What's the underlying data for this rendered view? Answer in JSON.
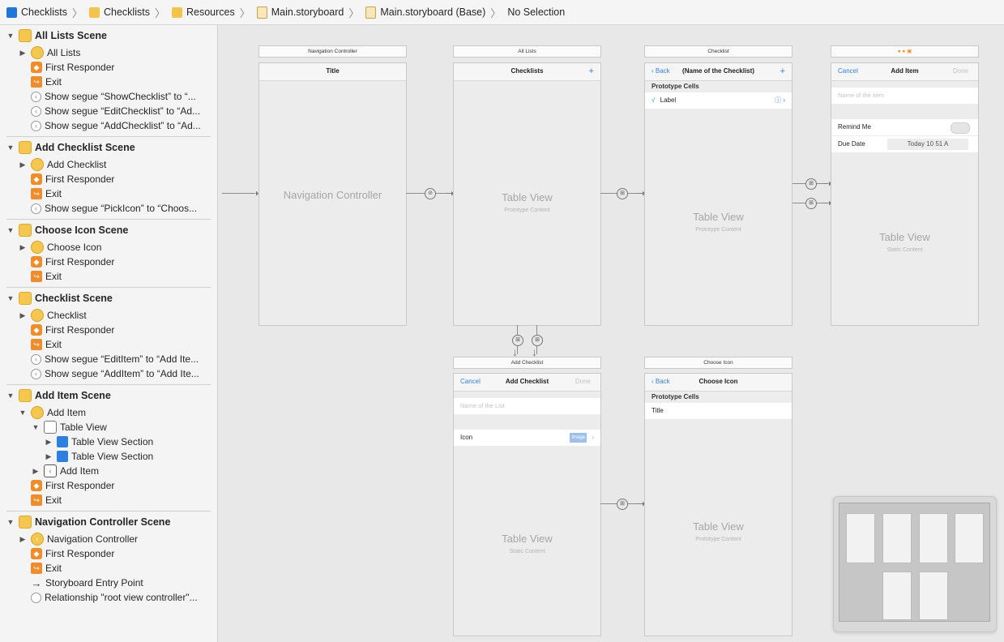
{
  "jumpbar": {
    "crumbs": [
      {
        "label": "Checklists",
        "icon": "project-icon"
      },
      {
        "label": "Checklists",
        "icon": "folder-icon"
      },
      {
        "label": "Resources",
        "icon": "folder-icon"
      },
      {
        "label": "Main.storyboard",
        "icon": "storyboard-icon"
      },
      {
        "label": "Main.storyboard (Base)",
        "icon": "storyboard-icon"
      },
      {
        "label": "No Selection",
        "icon": ""
      }
    ]
  },
  "outline": {
    "scenes": [
      {
        "title": "All Lists Scene",
        "items": [
          "All Lists",
          "First Responder",
          "Exit",
          "Show segue “ShowChecklist” to “...",
          "Show segue “EditChecklist” to “Ad...",
          "Show segue “AddChecklist” to “Ad..."
        ]
      },
      {
        "title": "Add Checklist Scene",
        "items": [
          "Add Checklist",
          "First Responder",
          "Exit",
          "Show segue “PickIcon” to “Choos..."
        ]
      },
      {
        "title": "Choose Icon Scene",
        "items": [
          "Choose Icon",
          "First Responder",
          "Exit"
        ]
      },
      {
        "title": "Checklist Scene",
        "items": [
          "Checklist",
          "First Responder",
          "Exit",
          "Show segue “EditItem” to “Add Ite...",
          "Show segue “AddItem” to “Add Ite..."
        ]
      },
      {
        "title": "Add Item Scene",
        "items": [
          "Add Item",
          "Table View",
          "Table View Section",
          "Table View Section",
          "Add Item",
          "First Responder",
          "Exit"
        ]
      },
      {
        "title": "Navigation Controller Scene",
        "items": [
          "Navigation Controller",
          "First Responder",
          "Exit",
          "Storyboard Entry Point",
          "Relationship \"root view controller\"..."
        ]
      }
    ]
  },
  "canvas": {
    "nav_controller": {
      "header": "Navigation Controller",
      "nav_title": "Title",
      "label": "Navigation Controller"
    },
    "all_lists": {
      "header": "All Lists",
      "nav_title": "Checklists",
      "add": "+",
      "label": "Table View",
      "sub": "Prototype Content"
    },
    "checklist": {
      "header": "Checklist",
      "back": "Back",
      "nav_title": "(Name of the Checklist)",
      "add": "+",
      "section": "Prototype Cells",
      "check": "√",
      "cell": "Label",
      "label": "Table View",
      "sub": "Prototype Content"
    },
    "add_item": {
      "cancel": "Cancel",
      "nav_title": "Add Item",
      "done": "Done",
      "placeholder": "Name of the item",
      "remind": "Remind Me",
      "due": "Due Date",
      "date": "Today  10 51  A",
      "label": "Table View",
      "sub": "Static Content"
    },
    "add_checklist": {
      "header": "Add Checklist",
      "cancel": "Cancel",
      "nav_title": "Add Checklist",
      "done": "Done",
      "placeholder": "Name of the List",
      "icon_label": "Icon",
      "icon_value": "Image",
      "label": "Table View",
      "sub": "Static Content"
    },
    "choose_icon": {
      "header": "Choose Icon",
      "back": "Back",
      "nav_title": "Choose Icon",
      "section": "Prototype Cells",
      "cell": "Title",
      "label": "Table View",
      "sub": "Prototype Content"
    }
  },
  "colors": {
    "accent": "#2f7fe0",
    "scene_icon": "#f6c74e",
    "responder": "#ee8e2b"
  }
}
